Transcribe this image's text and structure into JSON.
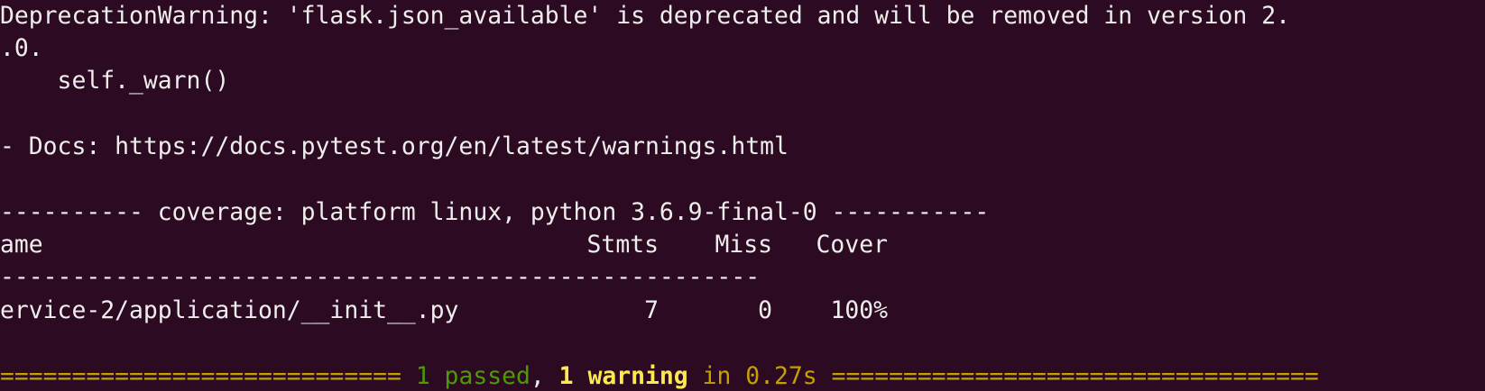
{
  "terminal": {
    "warning_line": "DeprecationWarning: 'flask.json_available' is deprecated and will be removed in version 2.",
    "warning_cont": ".0.",
    "warn_call": "    self._warn()",
    "docs_line": "- Docs: https://docs.pytest.org/en/latest/warnings.html",
    "coverage_header": "---------- coverage: platform linux, python 3.6.9-final-0 -----------",
    "table": {
      "headers": [
        "ame",
        "Stmts",
        "Miss",
        "Cover"
      ],
      "separator": "-----------------------------------------------------",
      "rows": [
        [
          "ervice-2/application/__init__.py",
          "7",
          "0",
          "100%"
        ]
      ]
    },
    "summary": {
      "left_sep": "============================",
      "passed": "1 passed",
      "comma": ",",
      "warning": "1 warning",
      "timing": "in 0.27s",
      "right_sep": "=================================="
    },
    "colors": {
      "background": "#2c0a22",
      "text": "#eeeeec",
      "separator_yellow": "#c4a000",
      "passed_green": "#4e9a06",
      "warning_yellow": "#fce94f"
    }
  }
}
